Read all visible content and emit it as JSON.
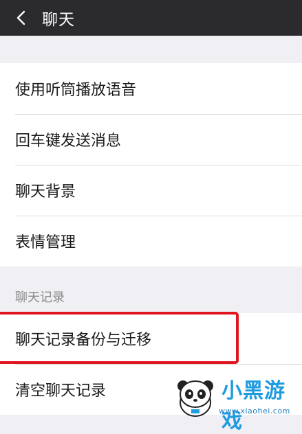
{
  "header": {
    "title": "聊天",
    "back_icon": "chevron-left-icon"
  },
  "settings": [
    {
      "label": "使用听筒播放语音"
    },
    {
      "label": "回车键发送消息"
    },
    {
      "label": "聊天背景"
    },
    {
      "label": "表情管理"
    }
  ],
  "chat_history_section": {
    "header": "聊天记录",
    "items": [
      {
        "label": "聊天记录备份与迁移",
        "highlighted": true
      },
      {
        "label": "清空聊天记录"
      }
    ]
  },
  "watermark": {
    "brand": "小黑游戏",
    "url": "www.xiaohei.com"
  },
  "colors": {
    "topbar": "#2b2b2d",
    "background": "#efeff4",
    "highlight": "#e0151f",
    "watermark": "#1f9be0"
  }
}
